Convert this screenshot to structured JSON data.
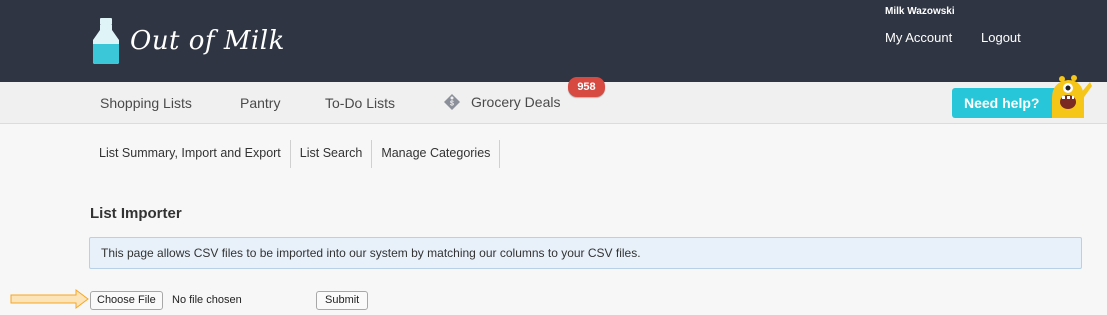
{
  "header": {
    "logo_text": "Out of Milk",
    "user_name": "Milk Wazowski",
    "my_account": "My Account",
    "logout": "Logout"
  },
  "nav": {
    "items": [
      {
        "label": "Shopping Lists"
      },
      {
        "label": "Pantry"
      },
      {
        "label": "To-Do Lists"
      },
      {
        "label": "Grocery Deals",
        "icon": "tag-icon"
      }
    ],
    "deals_badge": "958",
    "help_label": "Need help?"
  },
  "subnav": {
    "items": [
      {
        "label": "List Summary, Import and Export"
      },
      {
        "label": "List Search"
      },
      {
        "label": "Manage Categories"
      }
    ]
  },
  "main": {
    "title": "List Importer",
    "info": "This page allows CSV files to be imported into our system by matching our columns to your CSV files.",
    "choose_file_label": "Choose File",
    "file_status": "No file chosen",
    "submit_label": "Submit"
  },
  "colors": {
    "header_bg": "#2f3542",
    "accent": "#27c6d8",
    "badge": "#d74a42",
    "info_bg": "#e8f1fa",
    "arrow": "#f5a623"
  }
}
